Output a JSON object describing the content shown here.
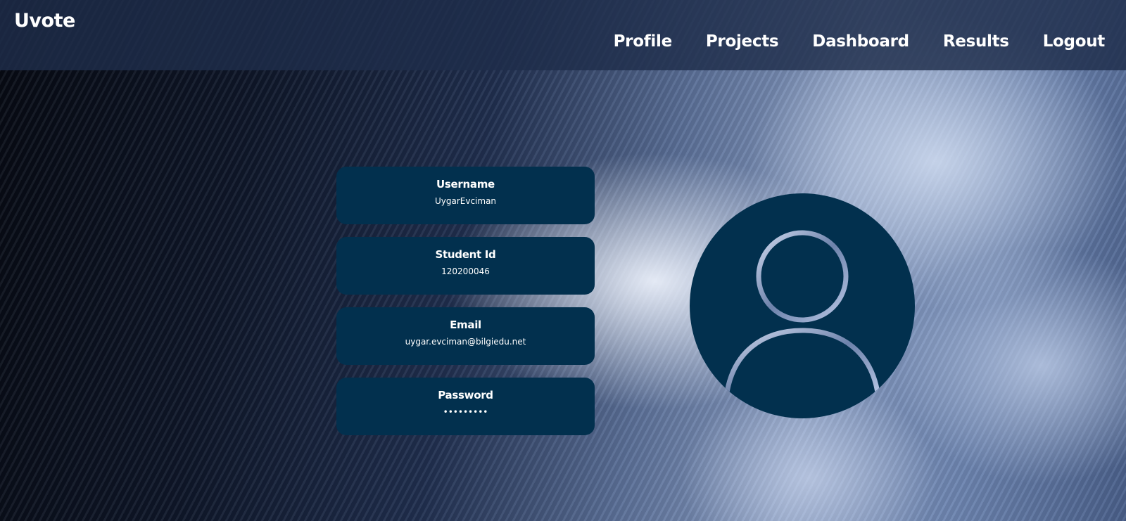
{
  "app": {
    "brand": "Uvote"
  },
  "nav": {
    "items": [
      {
        "label": "Profile"
      },
      {
        "label": "Projects"
      },
      {
        "label": "Dashboard"
      },
      {
        "label": "Results"
      },
      {
        "label": "Logout"
      }
    ]
  },
  "profile": {
    "username": {
      "label": "Username",
      "value": "UygarEvciman"
    },
    "student_id": {
      "label": "Student Id",
      "value": "120200046"
    },
    "email": {
      "label": "Email",
      "value": "uygar.evciman@bilgiedu.net"
    },
    "password": {
      "label": "Password",
      "value": "•••••••••"
    }
  },
  "avatar": {
    "icon": "user-avatar-icon"
  },
  "colors": {
    "card_bg": "#02304e",
    "navbar_bg": "#1e2d4b",
    "text": "#ffffff"
  }
}
